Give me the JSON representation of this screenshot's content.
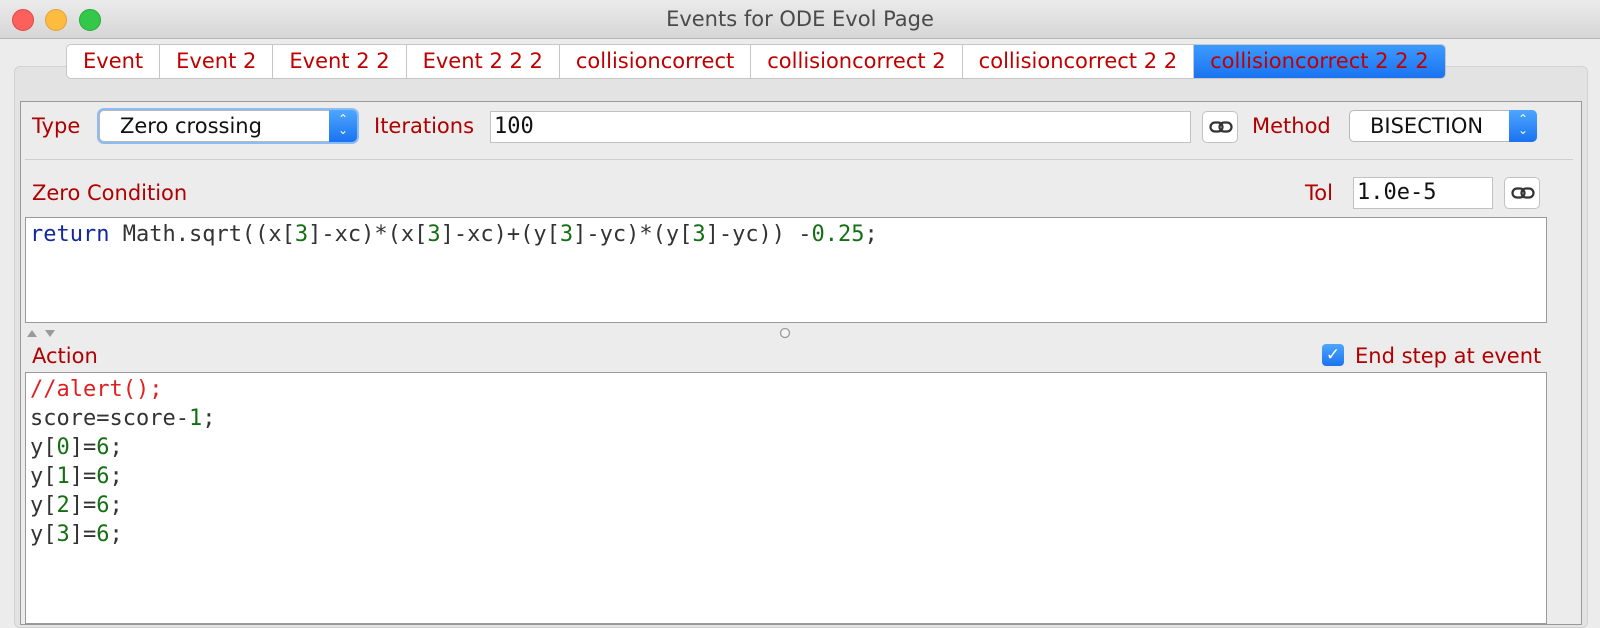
{
  "window": {
    "title": "Events for ODE Evol Page"
  },
  "tabs": [
    {
      "label": "Event",
      "active": false
    },
    {
      "label": "Event 2",
      "active": false
    },
    {
      "label": "Event 2 2",
      "active": false
    },
    {
      "label": "Event 2 2 2",
      "active": false
    },
    {
      "label": "collisioncorrect",
      "active": false
    },
    {
      "label": "collisioncorrect 2",
      "active": false
    },
    {
      "label": "collisioncorrect 2 2",
      "active": false
    },
    {
      "label": "collisioncorrect 2 2 2",
      "active": true
    }
  ],
  "settings": {
    "type_label": "Type",
    "type_value": "Zero crossing",
    "iterations_label": "Iterations",
    "iterations_value": "100",
    "method_label": "Method",
    "method_value": "BISECTION",
    "zero_condition_label": "Zero Condition",
    "tol_label": "Tol",
    "tol_value": "1.0e-5"
  },
  "zero_condition_code": {
    "tokens": [
      {
        "t": "return",
        "c": "kw"
      },
      {
        "t": " Math.sqrt((x[",
        "c": ""
      },
      {
        "t": "3",
        "c": "num"
      },
      {
        "t": "]-xc)*(x[",
        "c": ""
      },
      {
        "t": "3",
        "c": "num"
      },
      {
        "t": "]-xc)+(y[",
        "c": ""
      },
      {
        "t": "3",
        "c": "num"
      },
      {
        "t": "]-yc)*(y[",
        "c": ""
      },
      {
        "t": "3",
        "c": "num"
      },
      {
        "t": "]-yc)) -",
        "c": ""
      },
      {
        "t": "0.25",
        "c": "num"
      },
      {
        "t": ";",
        "c": ""
      }
    ]
  },
  "action": {
    "label": "Action",
    "end_step_label": "End step at event",
    "end_step_checked": true,
    "lines": [
      [
        {
          "t": "//alert();",
          "c": "cm"
        }
      ],
      [
        {
          "t": "score=score-",
          "c": ""
        },
        {
          "t": "1",
          "c": "num"
        },
        {
          "t": ";",
          "c": ""
        }
      ],
      [
        {
          "t": "y[",
          "c": ""
        },
        {
          "t": "0",
          "c": "num"
        },
        {
          "t": "]=",
          "c": ""
        },
        {
          "t": "6",
          "c": "num"
        },
        {
          "t": ";",
          "c": ""
        }
      ],
      [
        {
          "t": "y[",
          "c": ""
        },
        {
          "t": "1",
          "c": "num"
        },
        {
          "t": "]=",
          "c": ""
        },
        {
          "t": "6",
          "c": "num"
        },
        {
          "t": ";",
          "c": ""
        }
      ],
      [
        {
          "t": "y[",
          "c": ""
        },
        {
          "t": "2",
          "c": "num"
        },
        {
          "t": "]=",
          "c": ""
        },
        {
          "t": "6",
          "c": "num"
        },
        {
          "t": ";",
          "c": ""
        }
      ],
      [
        {
          "t": "y[",
          "c": ""
        },
        {
          "t": "3",
          "c": "num"
        },
        {
          "t": "]=",
          "c": ""
        },
        {
          "t": "6",
          "c": "num"
        },
        {
          "t": ";",
          "c": ""
        }
      ]
    ]
  },
  "icons": {
    "link": "link-icon",
    "updown": "up-down-chevron-icon",
    "check": "checkmark-icon"
  }
}
